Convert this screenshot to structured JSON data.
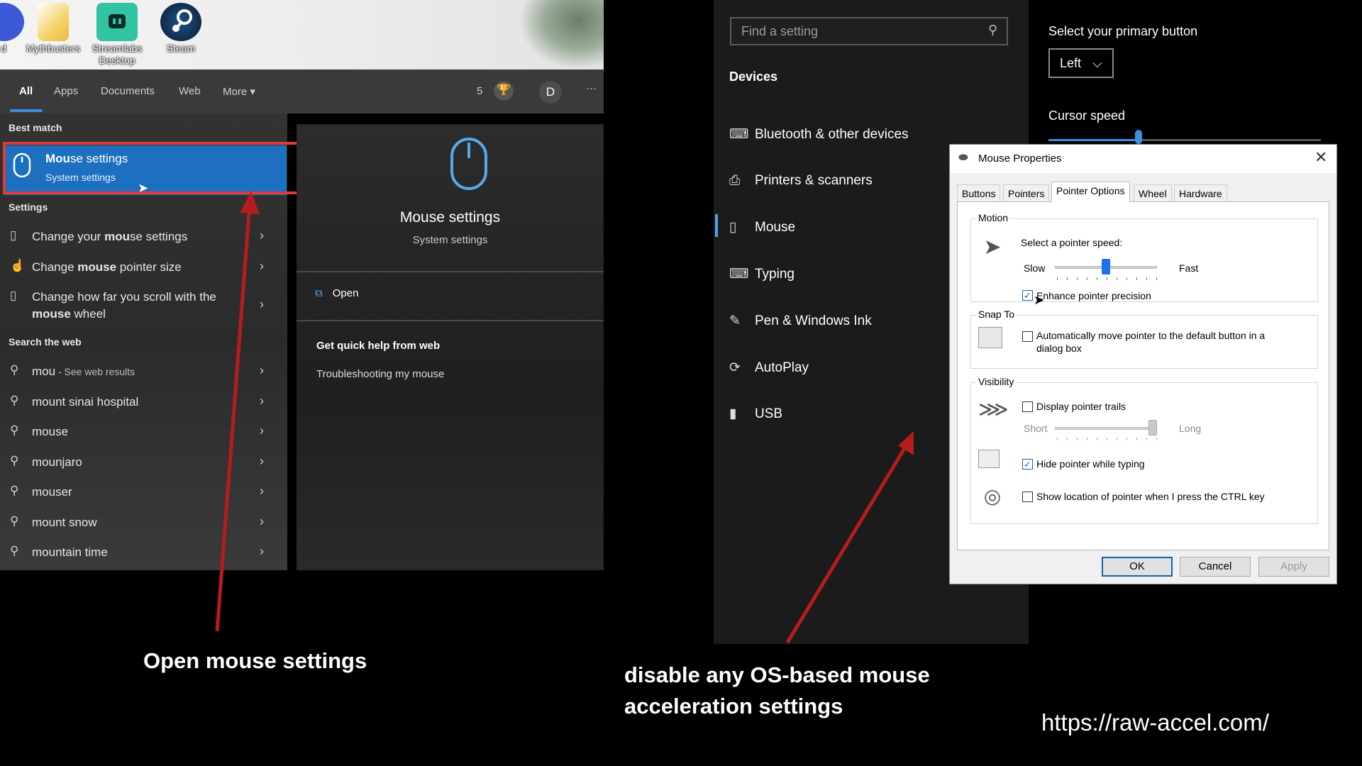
{
  "desktop": {
    "icons": [
      {
        "label": "d",
        "icon": "app-icon"
      },
      {
        "label": "Mythbusters",
        "icon": "folder-icon"
      },
      {
        "label": "Streamlabs Desktop",
        "icon": "streamlabs-icon"
      },
      {
        "label": "Steam",
        "icon": "steam-icon"
      }
    ]
  },
  "search": {
    "tabs": [
      "All",
      "Apps",
      "Documents",
      "Web",
      "More"
    ],
    "more_caret": "▾",
    "points": "5",
    "avatar_letter": "D",
    "overflow": "···",
    "best_match_header": "Best match",
    "best_match": {
      "title_bold": "Mou",
      "title_rest": "se settings",
      "subtitle": "System settings"
    },
    "settings_header": "Settings",
    "settings_items": [
      {
        "pre": "Change your ",
        "bold": "mou",
        "post": "se settings",
        "icon": "mouse-icon"
      },
      {
        "pre": "Change ",
        "bold": "mouse",
        "post": " pointer size",
        "icon": "pointer-icon"
      },
      {
        "pre": "Change how far you scroll with the ",
        "bold": "mouse",
        "post": " wheel",
        "icon": "mouse-icon"
      }
    ],
    "web_header": "Search the web",
    "web_items": [
      {
        "text": "mou",
        "sub": " - See web results"
      },
      {
        "text": "mount sinai hospital",
        "sub": ""
      },
      {
        "text": "mouse",
        "sub": ""
      },
      {
        "text": "mounjaro",
        "sub": ""
      },
      {
        "text": "mouser",
        "sub": ""
      },
      {
        "text": "mount snow",
        "sub": ""
      },
      {
        "text": "mountain time",
        "sub": ""
      }
    ],
    "preview": {
      "title": "Mouse settings",
      "subtitle": "System settings",
      "open_label": "Open",
      "help_header": "Get quick help from web",
      "help_link": "Troubleshooting my mouse"
    }
  },
  "settings": {
    "find_placeholder": "Find a setting",
    "section": "Devices",
    "nav": [
      {
        "label": "Bluetooth & other devices",
        "icon": "bluetooth-devices-icon"
      },
      {
        "label": "Printers & scanners",
        "icon": "printer-icon"
      },
      {
        "label": "Mouse",
        "icon": "mouse-icon",
        "active": true
      },
      {
        "label": "Typing",
        "icon": "keyboard-icon"
      },
      {
        "label": "Pen & Windows Ink",
        "icon": "pen-icon"
      },
      {
        "label": "AutoPlay",
        "icon": "autoplay-icon"
      },
      {
        "label": "USB",
        "icon": "usb-icon"
      }
    ],
    "primary_button_label": "Select your primary button",
    "primary_button_value": "Left",
    "cursor_speed_label": "Cursor speed",
    "cursor_speed_level": 0.33
  },
  "dialog": {
    "title": "Mouse Properties",
    "tabs": [
      "Buttons",
      "Pointers",
      "Pointer Options",
      "Wheel",
      "Hardware"
    ],
    "active_tab": "Pointer Options",
    "motion": {
      "group": "Motion",
      "speed_label": "Select a pointer speed:",
      "slow": "Slow",
      "fast": "Fast",
      "speed_level": 0.5,
      "enhance_label": "Enhance pointer precision",
      "enhance_checked": true
    },
    "snap": {
      "group": "Snap To",
      "auto_label_1": "Automatically move pointer to the default button in a",
      "auto_label_2": "dialog box",
      "checked": false
    },
    "visibility": {
      "group": "Visibility",
      "trails_label": "Display pointer trails",
      "trails_checked": false,
      "short": "Short",
      "long": "Long",
      "trails_level": 1.0,
      "hide_label": "Hide pointer while typing",
      "hide_checked": true,
      "ctrl_label": "Show location of pointer when I press the CTRL key",
      "ctrl_checked": false
    },
    "buttons": {
      "ok": "OK",
      "cancel": "Cancel",
      "apply": "Apply"
    }
  },
  "captions": {
    "left": "Open mouse settings",
    "right_1": "disable any OS-based mouse",
    "right_2": "acceleration settings",
    "url": "https://raw-accel.com/"
  },
  "colors": {
    "accent": "#1d6fbf",
    "highlight_box": "#e23a3a",
    "arrow": "#b71c1c",
    "slider_thumb": "#1a73e8"
  }
}
